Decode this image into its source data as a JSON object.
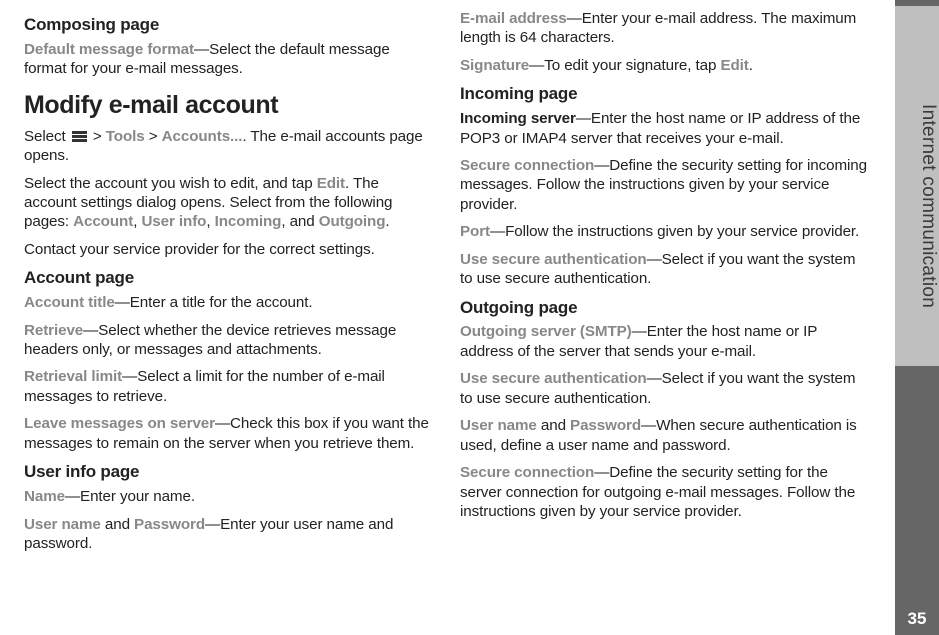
{
  "sidebar": {
    "label": "Internet communication",
    "page_number": "35"
  },
  "left": {
    "composing_heading": "Composing page",
    "dmf_label": "Default message format",
    "dmf_text": "—Select the default message format for your e-mail messages.",
    "modify_heading": "Modify e-mail account",
    "select_prefix": "Select ",
    "gt1": " > ",
    "tools": "Tools",
    "gt2": " > ",
    "accounts": "Accounts...",
    "select_suffix": ". The e-mail accounts page opens.",
    "edit_pre": "Select the account you wish to edit, and tap ",
    "edit_word": "Edit",
    "edit_post": ". The account settings dialog opens. Select from the following pages: ",
    "p_account": "Account",
    "p_sep1": ", ",
    "p_userinfo": "User info",
    "p_sep2": ", ",
    "p_incoming": "Incoming",
    "p_sep3": ", and ",
    "p_outgoing": "Outgoing",
    "p_end": ".",
    "contact": "Contact your service provider for the correct settings.",
    "account_heading": "Account page",
    "acct_title_label": "Account title",
    "acct_title_text": "—Enter a title for the account.",
    "retrieve_label": "Retrieve",
    "retrieve_text": "—Select whether the device retrieves message headers only, or messages and attachments.",
    "retlimit_label": "Retrieval limit",
    "retlimit_text": "—Select a limit for the number of e-mail messages to retrieve.",
    "leave_label": "Leave messages on server",
    "leave_text": "—Check this box if you want the messages to remain on the server when you retrieve them.",
    "userinfo_heading": "User info page",
    "name_label": "Name",
    "name_text": "—Enter your name.",
    "un_label": "User name",
    "and1": " and ",
    "pw_label": "Password",
    "unpw_text": "—Enter your user name and password."
  },
  "right": {
    "email_label": "E-mail address",
    "email_text": "—Enter your e-mail address. The maximum length is 64 characters.",
    "sig_label": "Signature",
    "sig_text_pre": "—To edit your signature, tap ",
    "sig_edit": "Edit",
    "sig_text_post": ".",
    "incoming_heading": "Incoming page",
    "inserver_label": "Incoming server",
    "inserver_text": "—Enter the host name or IP address of the POP3 or IMAP4 server that receives your e-mail.",
    "secconn_label": "Secure connection",
    "secconn_text": "—Define the security setting for incoming messages. Follow the instructions given by your service provider.",
    "port_label": "Port",
    "port_text": "—Follow the instructions given by your service provider.",
    "useauth_label": "Use secure authentication",
    "useauth_text": "—Select if you want the system to use secure authentication.",
    "outgoing_heading": "Outgoing page",
    "outserver_label": "Outgoing server (SMTP)",
    "outserver_text": "—Enter the host name or IP address of the server that sends your e-mail.",
    "useauth2_label": "Use secure authentication",
    "useauth2_text": "—Select if you want the system to use secure authentication.",
    "un2_label": "User name",
    "and2": " and ",
    "pw2_label": "Password",
    "unpw2_text": "—When secure authentication is used, define a user name and password.",
    "secconn2_label": "Secure connection",
    "secconn2_text": "—Define the security setting for the server connection for outgoing e-mail messages. Follow the instructions given by your service provider."
  }
}
